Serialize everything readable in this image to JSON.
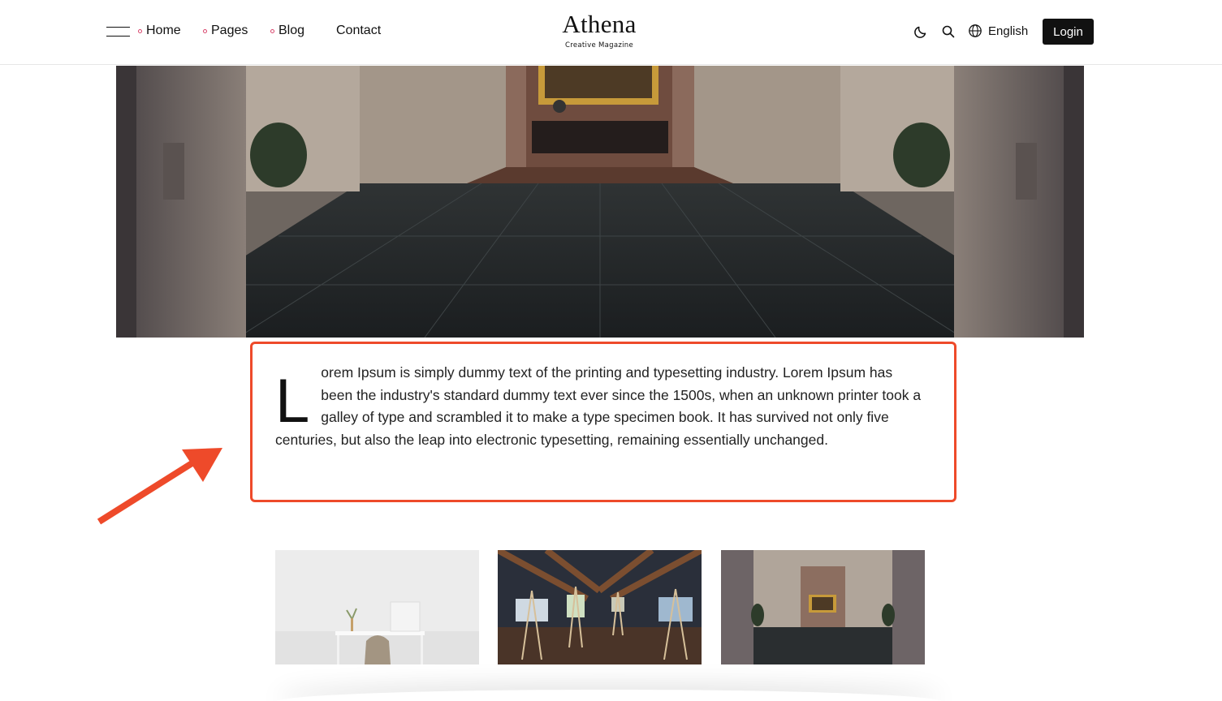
{
  "header": {
    "nav": [
      {
        "label": "Home"
      },
      {
        "label": "Pages"
      },
      {
        "label": "Blog"
      },
      {
        "label": "Contact"
      }
    ],
    "logo": {
      "name": "Athena",
      "tagline": "Creative Magazine"
    },
    "language": "English",
    "login_label": "Login",
    "icons": [
      "menu-icon",
      "moon-icon",
      "search-icon",
      "globe-icon"
    ]
  },
  "article": {
    "dropcap": "L",
    "text": "orem Ipsum is simply dummy text of the printing and typesetting industry. Lorem Ipsum has been the industry's standard dummy text ever since the 1500s, when an unknown printer took a galley of type and scrambled it to make a type specimen book. It has survived not only five centuries, but also the leap into electronic typesetting, remaining essentially unchanged."
  },
  "colors": {
    "accent": "#ee4a2a",
    "nav_dot": "#d9466d",
    "login_bg": "#111111"
  }
}
